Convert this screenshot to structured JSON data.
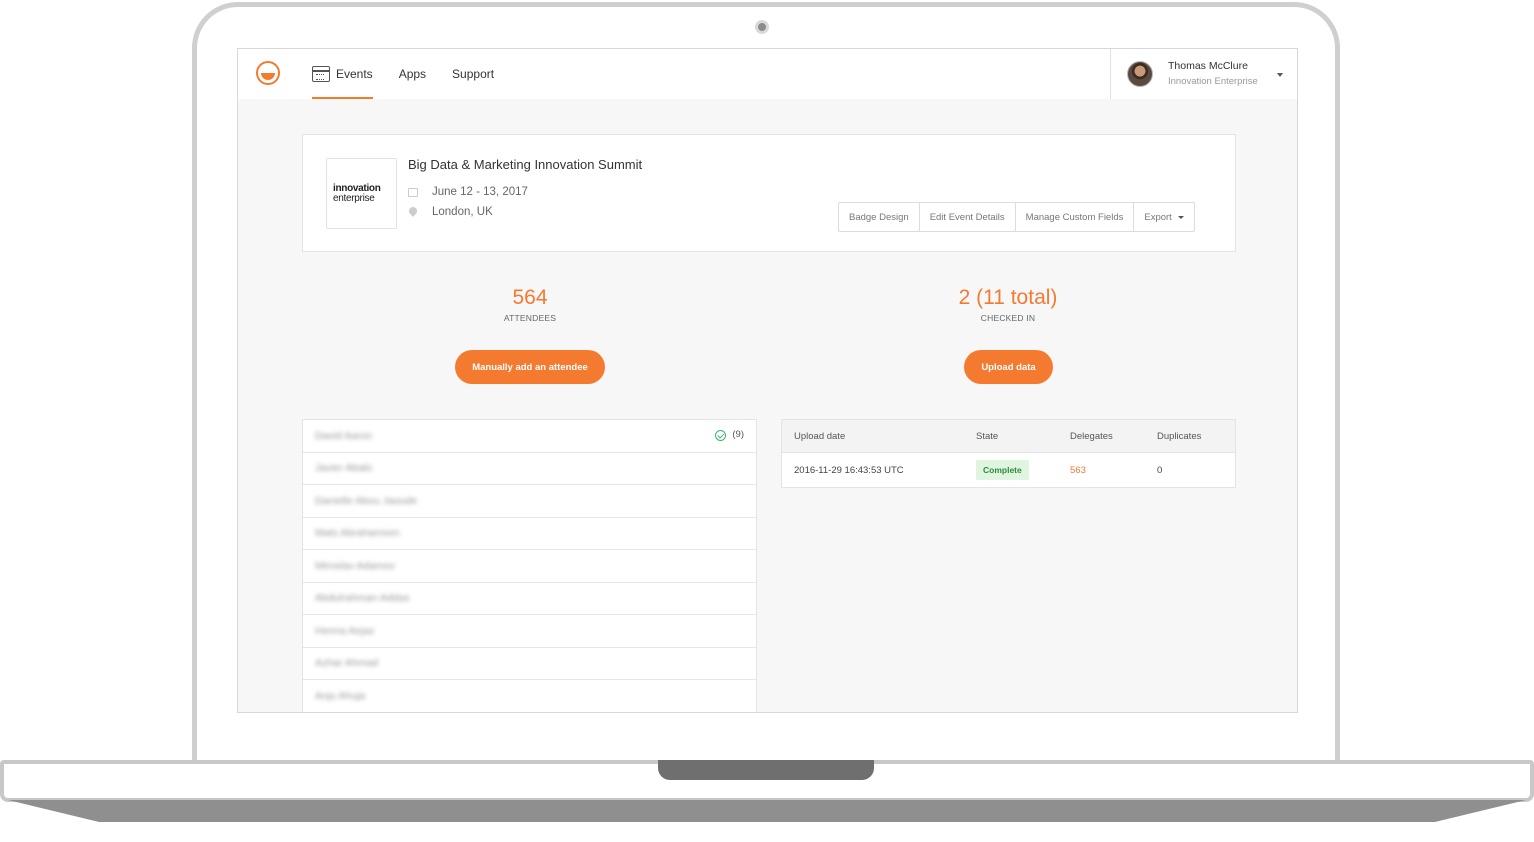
{
  "nav": {
    "items": [
      {
        "label": "Events"
      },
      {
        "label": "Apps"
      },
      {
        "label": "Support"
      }
    ]
  },
  "user": {
    "name": "Thomas McClure",
    "org": "Innovation Enterprise"
  },
  "event": {
    "logo_line1": "innovation",
    "logo_line2": "enterprise",
    "title": "Big Data & Marketing Innovation Summit",
    "dates": "June 12 - 13, 2017",
    "location": "London, UK",
    "actions": [
      "Badge Design",
      "Edit Event Details",
      "Manage Custom Fields",
      "Export"
    ]
  },
  "stats": {
    "attendees_value": "564",
    "attendees_label": "ATTENDEES",
    "checked_value": "2 (11 total)",
    "checked_label": "CHECKED IN",
    "add_button": "Manually add an attendee",
    "upload_button": "Upload data"
  },
  "attendees": [
    {
      "name": "David Aaron",
      "checkins": "(9)"
    },
    {
      "name": "Javier Abalo"
    },
    {
      "name": "Danielle Abou Jaoude"
    },
    {
      "name": "Mats Abrahamsen"
    },
    {
      "name": "Miroslav Adamov"
    },
    {
      "name": "Abdulrahman Addas"
    },
    {
      "name": "Henna Aejaz"
    },
    {
      "name": "Azhar Ahmad"
    },
    {
      "name": "Anju Ahuja"
    }
  ],
  "uploads": {
    "headers": [
      "Upload date",
      "State",
      "Delegates",
      "Duplicates"
    ],
    "rows": [
      {
        "date": "2016-11-29 16:43:53 UTC",
        "state": "Complete",
        "delegates": "563",
        "duplicates": "0"
      }
    ]
  },
  "colors": {
    "accent": "#f47a30",
    "success": "#3cb371"
  }
}
